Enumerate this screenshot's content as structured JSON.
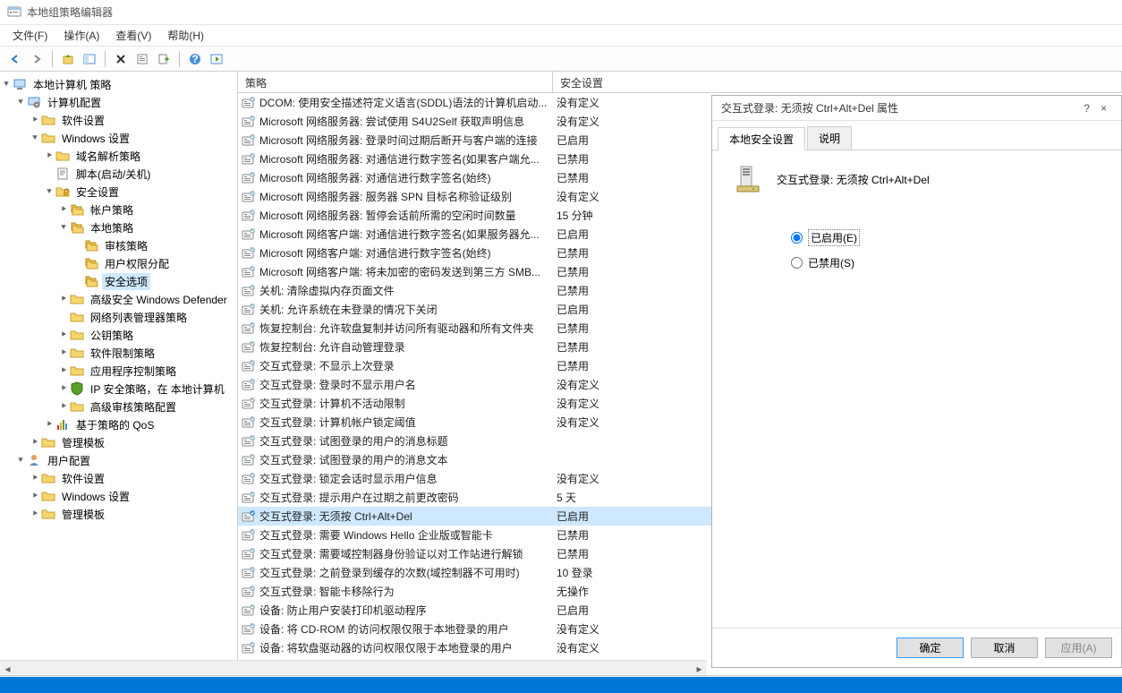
{
  "window_title": "本地组策略编辑器",
  "menu": {
    "file": "文件(F)",
    "action": "操作(A)",
    "view": "查看(V)",
    "help": "帮助(H)"
  },
  "tree": [
    {
      "lvl": 0,
      "open": true,
      "icon": "pc",
      "label": "本地计算机 策略"
    },
    {
      "lvl": 1,
      "open": true,
      "icon": "gear",
      "label": "计算机配置"
    },
    {
      "lvl": 2,
      "open": false,
      "icon": "folder",
      "label": "软件设置"
    },
    {
      "lvl": 2,
      "open": true,
      "icon": "folder",
      "label": "Windows 设置"
    },
    {
      "lvl": 3,
      "open": false,
      "icon": "folder",
      "label": "域名解析策略"
    },
    {
      "lvl": 3,
      "open": null,
      "icon": "script",
      "label": "脚本(启动/关机)"
    },
    {
      "lvl": 3,
      "open": true,
      "icon": "lock",
      "label": "安全设置"
    },
    {
      "lvl": 4,
      "open": false,
      "icon": "folders",
      "label": "帐户策略"
    },
    {
      "lvl": 4,
      "open": true,
      "icon": "folders",
      "label": "本地策略"
    },
    {
      "lvl": 5,
      "open": null,
      "icon": "folders",
      "label": "审核策略"
    },
    {
      "lvl": 5,
      "open": null,
      "icon": "folders",
      "label": "用户权限分配"
    },
    {
      "lvl": 5,
      "open": null,
      "icon": "folders",
      "label": "安全选项",
      "selected": true
    },
    {
      "lvl": 4,
      "open": false,
      "icon": "folder",
      "label": "高级安全 Windows Defender"
    },
    {
      "lvl": 4,
      "open": null,
      "icon": "folder",
      "label": "网络列表管理器策略"
    },
    {
      "lvl": 4,
      "open": false,
      "icon": "folder",
      "label": "公钥策略"
    },
    {
      "lvl": 4,
      "open": false,
      "icon": "folder",
      "label": "软件限制策略"
    },
    {
      "lvl": 4,
      "open": false,
      "icon": "folder",
      "label": "应用程序控制策略"
    },
    {
      "lvl": 4,
      "open": false,
      "icon": "shield",
      "label": "IP 安全策略，在 本地计算机"
    },
    {
      "lvl": 4,
      "open": false,
      "icon": "folder",
      "label": "高级审核策略配置"
    },
    {
      "lvl": 3,
      "open": false,
      "icon": "qos",
      "label": "基于策略的 QoS"
    },
    {
      "lvl": 2,
      "open": false,
      "icon": "folder",
      "label": "管理模板"
    },
    {
      "lvl": 1,
      "open": true,
      "icon": "user",
      "label": "用户配置"
    },
    {
      "lvl": 2,
      "open": false,
      "icon": "folder",
      "label": "软件设置"
    },
    {
      "lvl": 2,
      "open": false,
      "icon": "folder",
      "label": "Windows 设置"
    },
    {
      "lvl": 2,
      "open": false,
      "icon": "folder",
      "label": "管理模板"
    }
  ],
  "list_header": {
    "policy": "策略",
    "setting": "安全设置"
  },
  "policies": [
    {
      "policy": "DCOM: 使用安全描述符定义语言(SDDL)语法的计算机启动...",
      "setting": "没有定义"
    },
    {
      "policy": "Microsoft 网络服务器: 尝试使用 S4U2Self 获取声明信息",
      "setting": "没有定义"
    },
    {
      "policy": "Microsoft 网络服务器: 登录时间过期后断开与客户端的连接",
      "setting": "已启用"
    },
    {
      "policy": "Microsoft 网络服务器: 对通信进行数字签名(如果客户端允...",
      "setting": "已禁用"
    },
    {
      "policy": "Microsoft 网络服务器: 对通信进行数字签名(始终)",
      "setting": "已禁用"
    },
    {
      "policy": "Microsoft 网络服务器: 服务器 SPN 目标名称验证级别",
      "setting": "没有定义"
    },
    {
      "policy": "Microsoft 网络服务器: 暂停会话前所需的空闲时间数量",
      "setting": "15 分钟"
    },
    {
      "policy": "Microsoft 网络客户端: 对通信进行数字签名(如果服务器允...",
      "setting": "已启用"
    },
    {
      "policy": "Microsoft 网络客户端: 对通信进行数字签名(始终)",
      "setting": "已禁用"
    },
    {
      "policy": "Microsoft 网络客户端: 将未加密的密码发送到第三方 SMB...",
      "setting": "已禁用"
    },
    {
      "policy": "关机: 清除虚拟内存页面文件",
      "setting": "已禁用"
    },
    {
      "policy": "关机: 允许系统在未登录的情况下关闭",
      "setting": "已启用"
    },
    {
      "policy": "恢复控制台: 允许软盘复制并访问所有驱动器和所有文件夹",
      "setting": "已禁用"
    },
    {
      "policy": "恢复控制台: 允许自动管理登录",
      "setting": "已禁用"
    },
    {
      "policy": "交互式登录: 不显示上次登录",
      "setting": "已禁用"
    },
    {
      "policy": "交互式登录: 登录时不显示用户名",
      "setting": "没有定义"
    },
    {
      "policy": "交互式登录: 计算机不活动限制",
      "setting": "没有定义"
    },
    {
      "policy": "交互式登录: 计算机帐户锁定阈值",
      "setting": "没有定义"
    },
    {
      "policy": "交互式登录: 试图登录的用户的消息标题",
      "setting": ""
    },
    {
      "policy": "交互式登录: 试图登录的用户的消息文本",
      "setting": ""
    },
    {
      "policy": "交互式登录: 锁定会话时显示用户信息",
      "setting": "没有定义"
    },
    {
      "policy": "交互式登录: 提示用户在过期之前更改密码",
      "setting": "5 天"
    },
    {
      "policy": "交互式登录: 无须按 Ctrl+Alt+Del",
      "setting": "已启用",
      "selected": true
    },
    {
      "policy": "交互式登录: 需要 Windows Hello 企业版或智能卡",
      "setting": "已禁用"
    },
    {
      "policy": "交互式登录: 需要域控制器身份验证以对工作站进行解锁",
      "setting": "已禁用"
    },
    {
      "policy": "交互式登录: 之前登录到缓存的次数(域控制器不可用时)",
      "setting": "10 登录"
    },
    {
      "policy": "交互式登录: 智能卡移除行为",
      "setting": "无操作"
    },
    {
      "policy": "设备: 防止用户安装打印机驱动程序",
      "setting": "已启用"
    },
    {
      "policy": "设备: 将 CD-ROM 的访问权限仅限于本地登录的用户",
      "setting": "没有定义"
    },
    {
      "policy": "设备: 将软盘驱动器的访问权限仅限于本地登录的用户",
      "setting": "没有定义"
    }
  ],
  "dialog": {
    "title": "交互式登录: 无须按 Ctrl+Alt+Del 属性",
    "help_label": "?",
    "close_label": "×",
    "tabs": {
      "local": "本地安全设置",
      "explain": "说明"
    },
    "policy_name": "交互式登录: 无须按 Ctrl+Alt+Del",
    "radio_enabled": "已启用(E)",
    "radio_disabled": "已禁用(S)",
    "btn_ok": "确定",
    "btn_cancel": "取消",
    "btn_apply": "应用(A)"
  }
}
